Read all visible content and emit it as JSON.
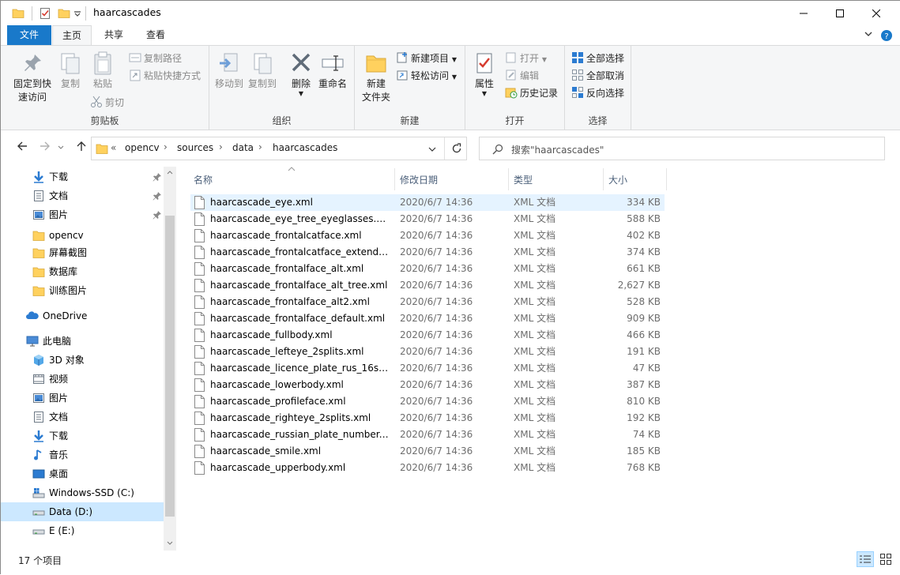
{
  "titlebar": {
    "title": "haarcascades"
  },
  "ribbon_tabs": {
    "file": "文件",
    "home": "主页",
    "share": "共享",
    "view": "查看"
  },
  "ribbon": {
    "clipboard": {
      "pin_label_1": "固定到快",
      "pin_label_2": "速访问",
      "copy": "复制",
      "paste": "粘贴",
      "copy_path": "复制路径",
      "paste_shortcut": "粘贴快捷方式",
      "cut": "剪切",
      "group": "剪贴板"
    },
    "organize": {
      "move_to": "移动到",
      "copy_to": "复制到",
      "delete": "删除",
      "rename": "重命名",
      "group": "组织"
    },
    "new": {
      "new_folder_1": "新建",
      "new_folder_2": "文件夹",
      "new_item": "新建项目",
      "easy_access": "轻松访问",
      "group": "新建"
    },
    "open": {
      "properties": "属性",
      "open": "打开",
      "edit": "编辑",
      "history": "历史记录",
      "group": "打开"
    },
    "select": {
      "select_all": "全部选择",
      "select_none": "全部取消",
      "invert": "反向选择",
      "group": "选择"
    }
  },
  "address": {
    "overflow": "«",
    "crumbs": [
      "opencv",
      "sources",
      "data",
      "haarcascades"
    ]
  },
  "search": {
    "placeholder": "搜索\"haarcascades\""
  },
  "nav": {
    "items": [
      {
        "label": "下载",
        "icon": "download-icon",
        "pinned": true
      },
      {
        "label": "文档",
        "icon": "document-icon",
        "pinned": true
      },
      {
        "label": "图片",
        "icon": "pictures-icon",
        "pinned": true
      },
      {
        "label": "opencv",
        "icon": "folder-icon"
      },
      {
        "label": "屏幕截图",
        "icon": "folder-icon"
      },
      {
        "label": "数据库",
        "icon": "folder-icon"
      },
      {
        "label": "训练图片",
        "icon": "folder-icon"
      },
      {
        "label": "OneDrive",
        "icon": "cloud-icon"
      },
      {
        "label": "此电脑",
        "icon": "computer-icon"
      },
      {
        "label": "3D 对象",
        "icon": "3d-objects-icon"
      },
      {
        "label": "视频",
        "icon": "video-icon"
      },
      {
        "label": "图片",
        "icon": "pictures-icon"
      },
      {
        "label": "文档",
        "icon": "document-icon"
      },
      {
        "label": "下载",
        "icon": "download-icon"
      },
      {
        "label": "音乐",
        "icon": "music-icon"
      },
      {
        "label": "桌面",
        "icon": "desktop-icon"
      },
      {
        "label": "Windows-SSD (C:)",
        "icon": "windows-drive-icon"
      },
      {
        "label": "Data (D:)",
        "icon": "drive-icon",
        "selected": true
      },
      {
        "label": "E (E:)",
        "icon": "drive-icon"
      }
    ]
  },
  "columns": {
    "name": "名称",
    "date": "修改日期",
    "type": "类型",
    "size": "大小"
  },
  "files": [
    {
      "name": "haarcascade_eye.xml",
      "date": "2020/6/7 14:36",
      "type": "XML 文档",
      "size": "334 KB"
    },
    {
      "name": "haarcascade_eye_tree_eyeglasses.xml",
      "date": "2020/6/7 14:36",
      "type": "XML 文档",
      "size": "588 KB"
    },
    {
      "name": "haarcascade_frontalcatface.xml",
      "date": "2020/6/7 14:36",
      "type": "XML 文档",
      "size": "402 KB"
    },
    {
      "name": "haarcascade_frontalcatface_extended...",
      "date": "2020/6/7 14:36",
      "type": "XML 文档",
      "size": "374 KB"
    },
    {
      "name": "haarcascade_frontalface_alt.xml",
      "date": "2020/6/7 14:36",
      "type": "XML 文档",
      "size": "661 KB"
    },
    {
      "name": "haarcascade_frontalface_alt_tree.xml",
      "date": "2020/6/7 14:36",
      "type": "XML 文档",
      "size": "2,627 KB"
    },
    {
      "name": "haarcascade_frontalface_alt2.xml",
      "date": "2020/6/7 14:36",
      "type": "XML 文档",
      "size": "528 KB"
    },
    {
      "name": "haarcascade_frontalface_default.xml",
      "date": "2020/6/7 14:36",
      "type": "XML 文档",
      "size": "909 KB"
    },
    {
      "name": "haarcascade_fullbody.xml",
      "date": "2020/6/7 14:36",
      "type": "XML 文档",
      "size": "466 KB"
    },
    {
      "name": "haarcascade_lefteye_2splits.xml",
      "date": "2020/6/7 14:36",
      "type": "XML 文档",
      "size": "191 KB"
    },
    {
      "name": "haarcascade_licence_plate_rus_16sta...",
      "date": "2020/6/7 14:36",
      "type": "XML 文档",
      "size": "47 KB"
    },
    {
      "name": "haarcascade_lowerbody.xml",
      "date": "2020/6/7 14:36",
      "type": "XML 文档",
      "size": "387 KB"
    },
    {
      "name": "haarcascade_profileface.xml",
      "date": "2020/6/7 14:36",
      "type": "XML 文档",
      "size": "810 KB"
    },
    {
      "name": "haarcascade_righteye_2splits.xml",
      "date": "2020/6/7 14:36",
      "type": "XML 文档",
      "size": "192 KB"
    },
    {
      "name": "haarcascade_russian_plate_number.xml",
      "date": "2020/6/7 14:36",
      "type": "XML 文档",
      "size": "74 KB"
    },
    {
      "name": "haarcascade_smile.xml",
      "date": "2020/6/7 14:36",
      "type": "XML 文档",
      "size": "185 KB"
    },
    {
      "name": "haarcascade_upperbody.xml",
      "date": "2020/6/7 14:36",
      "type": "XML 文档",
      "size": "768 KB"
    }
  ],
  "status": {
    "count": "17 个项目"
  },
  "colors": {
    "accent": "#1979ca",
    "hover_row": "#e5f3ff",
    "selected_nav": "#cce8ff",
    "folder": "#ffd15e"
  }
}
